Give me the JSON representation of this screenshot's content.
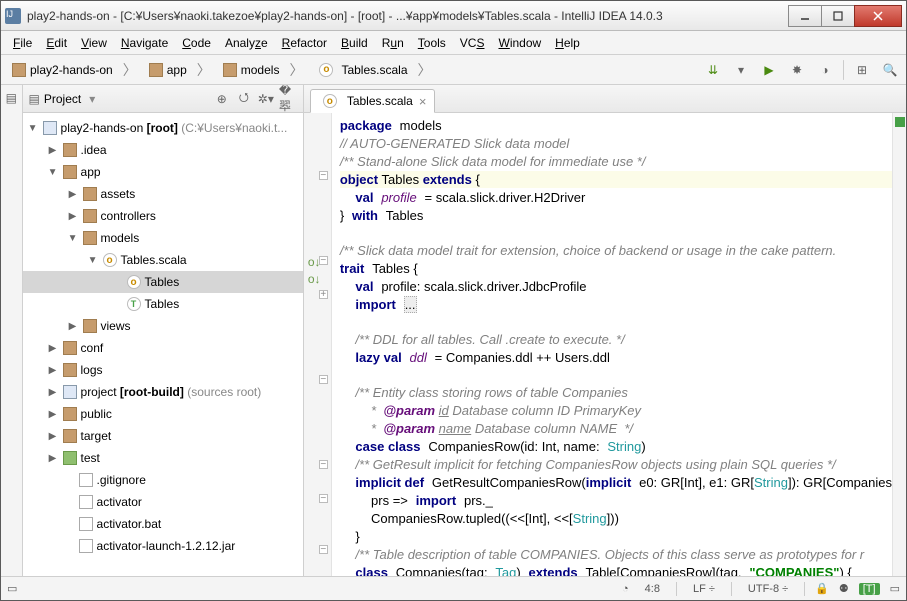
{
  "titlebar": {
    "text": "play2-hands-on - [C:¥Users¥naoki.takezoe¥play2-hands-on] - [root] - ...¥app¥models¥Tables.scala - IntelliJ IDEA 14.0.3"
  },
  "menu": [
    "File",
    "Edit",
    "View",
    "Navigate",
    "Code",
    "Analyze",
    "Refactor",
    "Build",
    "Run",
    "Tools",
    "VCS",
    "Window",
    "Help"
  ],
  "breadcrumbs": [
    "play2-hands-on",
    "app",
    "models",
    "Tables.scala"
  ],
  "project_panel": {
    "title": "Project",
    "root": {
      "name": "play2-hands-on",
      "suffix": "[root]",
      "gray": "(C:¥Users¥naoki.t..."
    },
    "idea": ".idea",
    "app": "app",
    "assets": "assets",
    "controllers": "controllers",
    "models": "models",
    "tables_scala": "Tables.scala",
    "tables_obj": "Tables",
    "tables_trait": "Tables",
    "views": "views",
    "conf": "conf",
    "logs": "logs",
    "project": {
      "name": "project",
      "suffix": "[root-build]",
      "gray": "(sources root)"
    },
    "public": "public",
    "target": "target",
    "test": "test",
    "gitignore": ".gitignore",
    "activator": "activator",
    "activator_bat": "activator.bat",
    "activator_jar": "activator-launch-1.2.12.jar"
  },
  "editor_tab": {
    "name": "Tables.scala"
  },
  "statusbar": {
    "pos": "4:8",
    "lf": "LF",
    "enc": "UTF-8",
    "insert_badge": "[T]"
  },
  "code": {
    "l1_kw": "package",
    "l1_pkg": "models",
    "l2": "// AUTO-GENERATED Slick data model",
    "l3": "/** Stand-alone Slick data model for immediate use */",
    "l4_kw1": "object",
    "l4_name": "Tables",
    "l4_kw2": "extends",
    "l4_brace": "{",
    "l5_kw": "val",
    "l5_id": "profile",
    "l5_rest": "= scala.slick.driver.H2Driver",
    "l6a": "}",
    "l6_kw": "with",
    "l6b": "Tables",
    "l8": "/** Slick data model trait for extension, choice of backend or usage in the cake pattern.",
    "l9_kw": "trait",
    "l9_name": "Tables {",
    "l10_kw": "val",
    "l10_rest": "profile: scala.slick.driver.JdbcProfile",
    "l11_kw": "import",
    "l11_dots": "...",
    "l13": "/** DDL for all tables. Call .create to execute. */",
    "l14_kw": "lazy val",
    "l14_id": "ddl",
    "l14_rest": "= Companies.ddl ++ Users.ddl",
    "l16": "/** Entity class storing rows of table Companies",
    "l17": "  *  @param id Database column ID PrimaryKey",
    "l17_param": "@param",
    "l17_id": "id",
    "l17_rest": "Database column ID PrimaryKey",
    "l18_param": "@param",
    "l18_id": "name",
    "l18_rest": "Database column NAME  */",
    "l19_kw": "case class",
    "l19_name": "CompaniesRow(id: Int, name:",
    "l19_type": "String",
    "l19_end": ")",
    "l20": "/** GetResult implicit for fetching CompaniesRow objects using plain SQL queries */",
    "l21_kw": "implicit def",
    "l21_name": "GetResultCompaniesRow(",
    "l21_kw2": "implicit",
    "l21_rest": "e0: GR[Int], e1: GR[",
    "l21_type": "String",
    "l21_end": "]): GR[Companies",
    "l22_a": "prs =>",
    "l22_kw": "import",
    "l22_b": "prs._",
    "l23_a": "CompaniesRow.tupled((<<[Int], <<[",
    "l23_type": "String",
    "l23_b": "]))",
    "l24": "}",
    "l25": "/** Table description of table COMPANIES. Objects of this class serve as prototypes for r",
    "l26_kw": "class",
    "l26_name": "Companies(tag:",
    "l26_type": "Tag",
    "l26_a": ")",
    "l26_kw2": "extends",
    "l26_b": "Table[CompaniesRow](tag,",
    "l26_str": "\"COMPANIES\"",
    "l26_c": ") {"
  }
}
